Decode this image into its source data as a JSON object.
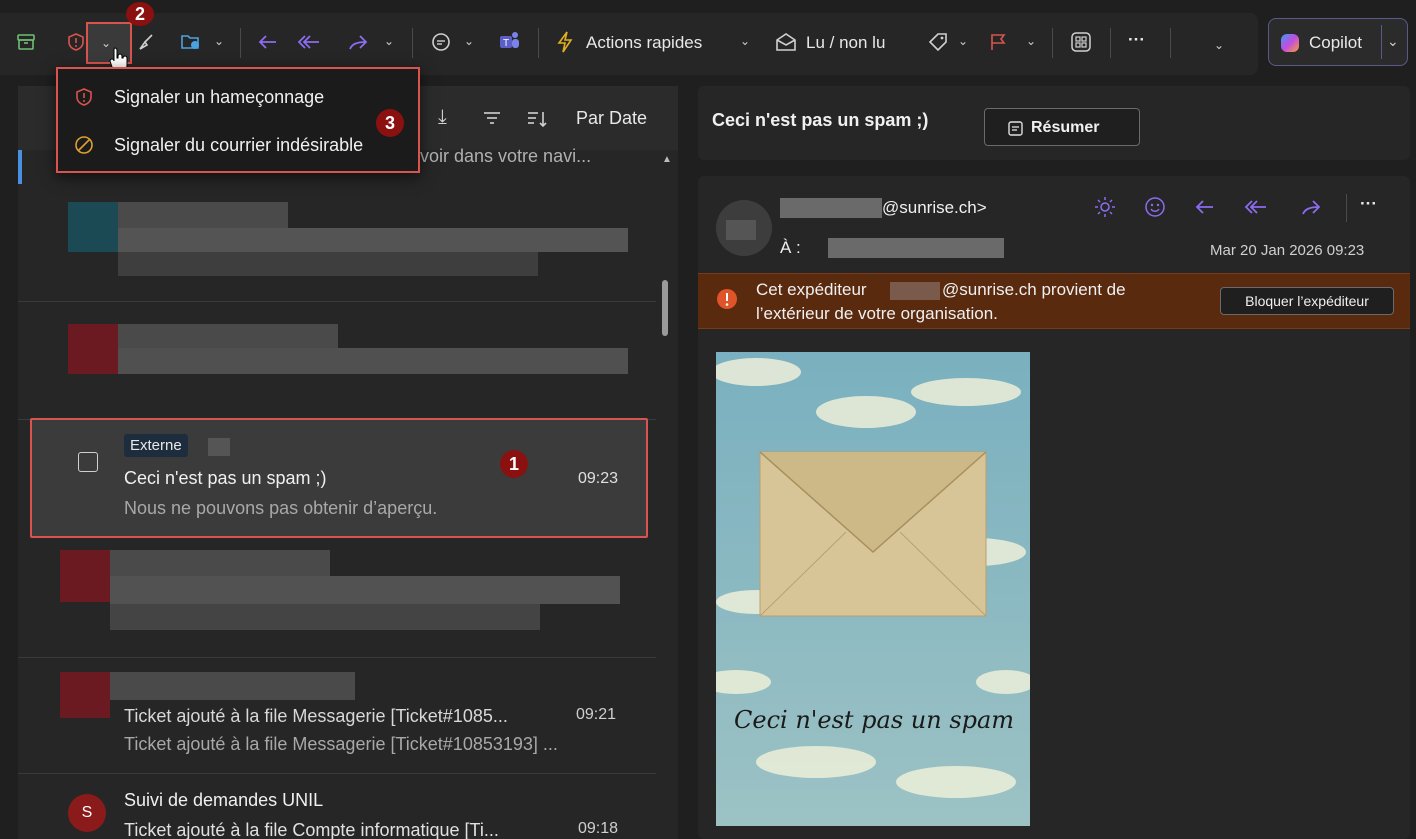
{
  "toolbar": {
    "quick_actions_label": "Actions rapides",
    "read_unread_label": "Lu / non lu",
    "more_label": "···",
    "copilot_label": "Copilot"
  },
  "dropdown": {
    "items": [
      {
        "label": "Signaler un hameçonnage",
        "icon": "shield-alert-icon",
        "color": "#d9534f"
      },
      {
        "label": "Signaler du courrier indésirable",
        "icon": "prohibited-icon",
        "color": "#e0a030"
      }
    ]
  },
  "list": {
    "sort_label": "Par Date",
    "top_preview_fragment": "voir dans votre navi...",
    "selected": {
      "tag": "Externe",
      "subject": "Ceci n'est pas un spam ;)",
      "preview": "Nous ne pouvons pas obtenir d’aperçu.",
      "time": "09:23"
    },
    "partial_row": {
      "subject": "Ticket ajouté à la file Messagerie [Ticket#1085...",
      "time": "09:21",
      "preview": "Ticket ajouté à la file Messagerie [Ticket#10853193] ..."
    },
    "last_row": {
      "avatar": "S",
      "sender": "Suivi de demandes UNIL",
      "preview": "Ticket ajouté à la file Compte informatique [Ti...",
      "time": "09:18"
    }
  },
  "reading": {
    "subject": "Ceci n'est pas un spam ;)",
    "summarize_label": "Résumer",
    "from_suffix": "@sunrise.ch>",
    "to_label": "À :",
    "date": "Mar 20 Jan 2026 09:23",
    "warning_prefix": "Cet expéditeur",
    "warning_domain": "@sunrise.ch provient de",
    "warning_line2": "l’extérieur de votre organisation.",
    "block_sender_label": "Bloquer l’expéditeur",
    "image_caption": "Ceci n'est pas un spam"
  },
  "annotations": {
    "step1": "1",
    "step2": "2",
    "step3": "3",
    "highlight_color": "#d9534f"
  },
  "colors": {
    "accent": "#9a7bff",
    "warning_bg": "#5a2a0f",
    "warning_icon": "#e0542a"
  }
}
